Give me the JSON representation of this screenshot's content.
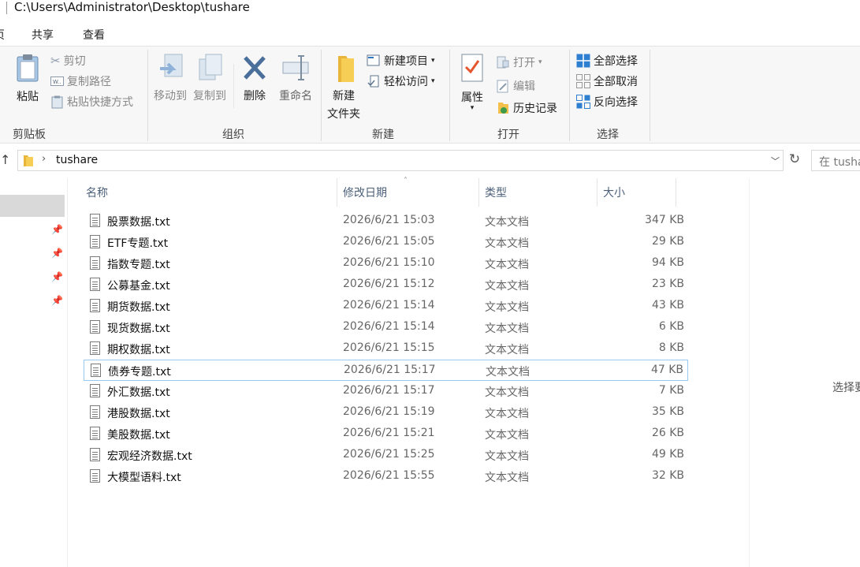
{
  "window": {
    "title": "C:\\Users\\Administrator\\Desktop\\tushare"
  },
  "ribbon_tabs": [
    {
      "label": "页"
    },
    {
      "label": "共享"
    },
    {
      "label": "查看"
    }
  ],
  "ribbon": {
    "clipboard": {
      "paste": "粘贴",
      "cut": "剪切",
      "copy_path": "复制路径",
      "paste_shortcut": "粘贴快捷方式",
      "group": "剪贴板"
    },
    "organize": {
      "move_to": "移动到",
      "copy_to": "复制到",
      "delete": "删除",
      "rename": "重命名",
      "group": "组织"
    },
    "new": {
      "new_folder_line1": "新建",
      "new_folder_line2": "文件夹",
      "new_item": "新建项目",
      "easy_access": "轻松访问",
      "group": "新建"
    },
    "open": {
      "properties": "属性",
      "open": "打开",
      "edit": "编辑",
      "history": "历史记录",
      "group": "打开"
    },
    "select": {
      "select_all": "全部选择",
      "select_none": "全部取消",
      "invert": "反向选择",
      "group": "选择"
    }
  },
  "address": {
    "path": "tushare",
    "search_placeholder": "在 tusha"
  },
  "columns": {
    "name": "名称",
    "date": "修改日期",
    "type": "类型",
    "size": "大小"
  },
  "files": [
    {
      "name": "股票数据.txt",
      "date": "2026/6/21 15:03",
      "type": "文本文档",
      "size": "347 KB"
    },
    {
      "name": "ETF专题.txt",
      "date": "2026/6/21 15:05",
      "type": "文本文档",
      "size": "29 KB"
    },
    {
      "name": "指数专题.txt",
      "date": "2026/6/21 15:10",
      "type": "文本文档",
      "size": "94 KB"
    },
    {
      "name": "公募基金.txt",
      "date": "2026/6/21 15:12",
      "type": "文本文档",
      "size": "23 KB"
    },
    {
      "name": "期货数据.txt",
      "date": "2026/6/21 15:14",
      "type": "文本文档",
      "size": "43 KB"
    },
    {
      "name": "现货数据.txt",
      "date": "2026/6/21 15:14",
      "type": "文本文档",
      "size": "6 KB"
    },
    {
      "name": "期权数据.txt",
      "date": "2026/6/21 15:15",
      "type": "文本文档",
      "size": "8 KB"
    },
    {
      "name": "债券专题.txt",
      "date": "2026/6/21 15:17",
      "type": "文本文档",
      "size": "47 KB"
    },
    {
      "name": "外汇数据.txt",
      "date": "2026/6/21 15:17",
      "type": "文本文档",
      "size": "7 KB"
    },
    {
      "name": "港股数据.txt",
      "date": "2026/6/21 15:19",
      "type": "文本文档",
      "size": "35 KB"
    },
    {
      "name": "美股数据.txt",
      "date": "2026/6/21 15:21",
      "type": "文本文档",
      "size": "26 KB"
    },
    {
      "name": "宏观经济数据.txt",
      "date": "2026/6/21 15:25",
      "type": "文本文档",
      "size": "49 KB"
    },
    {
      "name": "大模型语料.txt",
      "date": "2026/6/21 15:55",
      "type": "文本文档",
      "size": "32 KB"
    }
  ],
  "details_pane": {
    "message": "选择要"
  },
  "colors": {
    "accent": "#0078d7",
    "focus_border": "#99c9ef",
    "selected_nav": "#d9d9d9"
  }
}
